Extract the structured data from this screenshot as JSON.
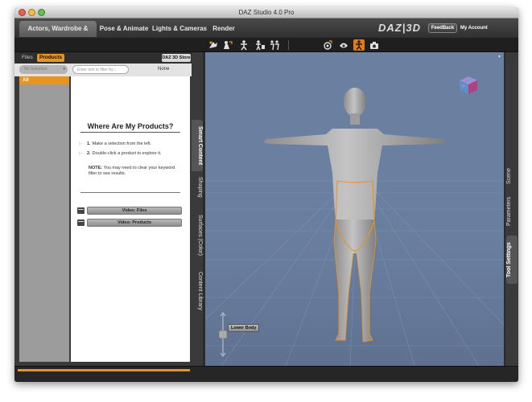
{
  "window": {
    "title": "DAZ Studio 4.0 Pro"
  },
  "tabs": [
    {
      "label": "Actors, Wardrobe & Props",
      "active": true
    },
    {
      "label": "Pose & Animate",
      "active": false
    },
    {
      "label": "Lights & Cameras",
      "active": false
    },
    {
      "label": "Render",
      "active": false
    }
  ],
  "header": {
    "logo": "DAZ|3D",
    "feedback": "FeedBack",
    "account": "My Account"
  },
  "toolbar": {
    "left_tools": [
      "node-select-icon",
      "universal-tool-icon",
      "pose-tool-icon",
      "joint-editor-icon",
      "rotate-figure-icon"
    ],
    "right_tools": [
      "camera-orbit-icon",
      "spot-render-icon",
      "figure-select-icon",
      "render-icon"
    ],
    "active_tool": "figure-select-icon"
  },
  "left_pane": {
    "tabs": [
      {
        "label": "Files",
        "active": false
      },
      {
        "label": "Products",
        "active": true
      }
    ],
    "store_button": "DAZ 3D Store",
    "selection_dropdown": "No Selection",
    "filter_placeholder": "Enter text to filter by...",
    "none_label": "None",
    "categories": [
      {
        "label": "All",
        "selected": true
      }
    ],
    "content": {
      "title": "Where Are My Products?",
      "step1": "Make a selection from the left.",
      "step2": "Double-click a product to explore it.",
      "step1_num": "1.",
      "step2_num": "2.",
      "note_label": "NOTE:",
      "note_text": "You may need to clear your keyword filter to see results.",
      "video_files": "Video: Files",
      "video_products": "Video: Products"
    }
  },
  "side_tabs": [
    {
      "label": "Smart Content",
      "active": true
    },
    {
      "label": "Shaping",
      "active": false
    },
    {
      "label": "Surfaces (Color)",
      "active": false
    },
    {
      "label": "Content Library",
      "active": false
    }
  ],
  "right_tabs": [
    {
      "label": "Scene",
      "active": false
    },
    {
      "label": "Parameters",
      "active": false
    },
    {
      "label": "Tool Settings",
      "active": true
    }
  ],
  "viewport": {
    "selection_label": "Lower Body"
  },
  "colors": {
    "accent": "#e8941f",
    "viewport_bg": "#6b7fa0",
    "figure": "#a9a9a9",
    "selection_outline": "#e8941f"
  }
}
